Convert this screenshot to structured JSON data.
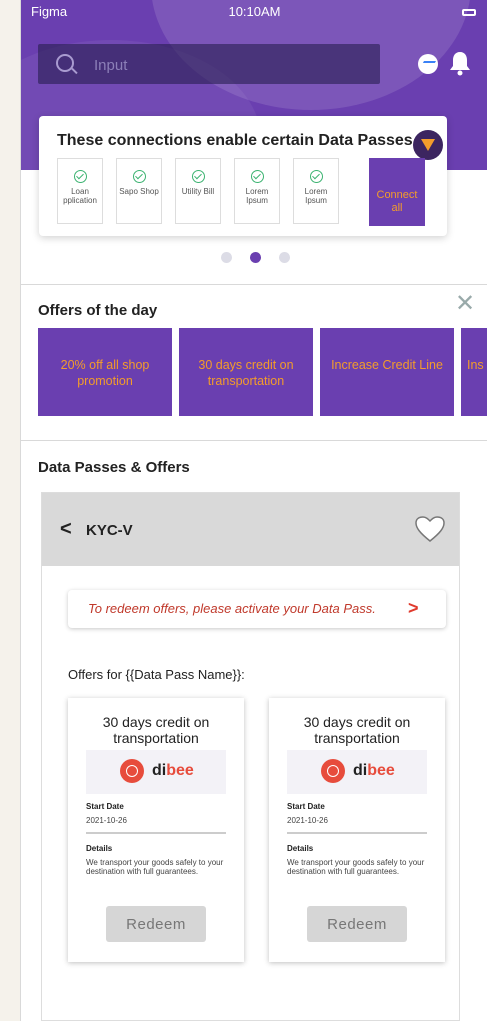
{
  "status_bar": {
    "app": "Figma",
    "time": "10:10AM"
  },
  "search": {
    "placeholder": "Input"
  },
  "connections": {
    "title": "These connections enable certain Data Passes",
    "items": [
      {
        "label": "Loan pplication"
      },
      {
        "label": "Sapo Shop"
      },
      {
        "label": "Utility Bill"
      },
      {
        "label": "Lorem Ipsum"
      },
      {
        "label": "Lorem Ipsum"
      }
    ],
    "connect_all": "Connect all",
    "carousel": {
      "pages": 3,
      "active": 2
    }
  },
  "offers_of_day": {
    "title": "Offers of the day",
    "tiles": [
      "20% off all shop promotion",
      "30 days credit on transportation",
      "Increase Credit Line",
      "Ins"
    ]
  },
  "data_passes": {
    "title": "Data Passes & Offers",
    "pass_name": "KYC-V",
    "banner": "To redeem offers, please activate your Data Pass.",
    "offers_heading": "Offers for {{Data Pass Name}}:",
    "cards": [
      {
        "title": "30 days credit on transportation",
        "brand_a": "di",
        "brand_b": "bee",
        "start_label": "Start Date",
        "start_value": "2021-10-26",
        "details_label": "Details",
        "details_value": "We transport your goods safely to your destination with full guarantees.",
        "button": "Redeem"
      },
      {
        "title": "30 days credit on transportation",
        "brand_a": "di",
        "brand_b": "bee",
        "start_label": "Start Date",
        "start_value": "2021-10-26",
        "details_label": "Details",
        "details_value": "We transport your goods safely to your destination with full guarantees.",
        "button": "Redeem"
      }
    ]
  },
  "colors": {
    "primary": "#6a3fb0",
    "accent": "#f39c2b",
    "alert": "#e03a2d"
  }
}
